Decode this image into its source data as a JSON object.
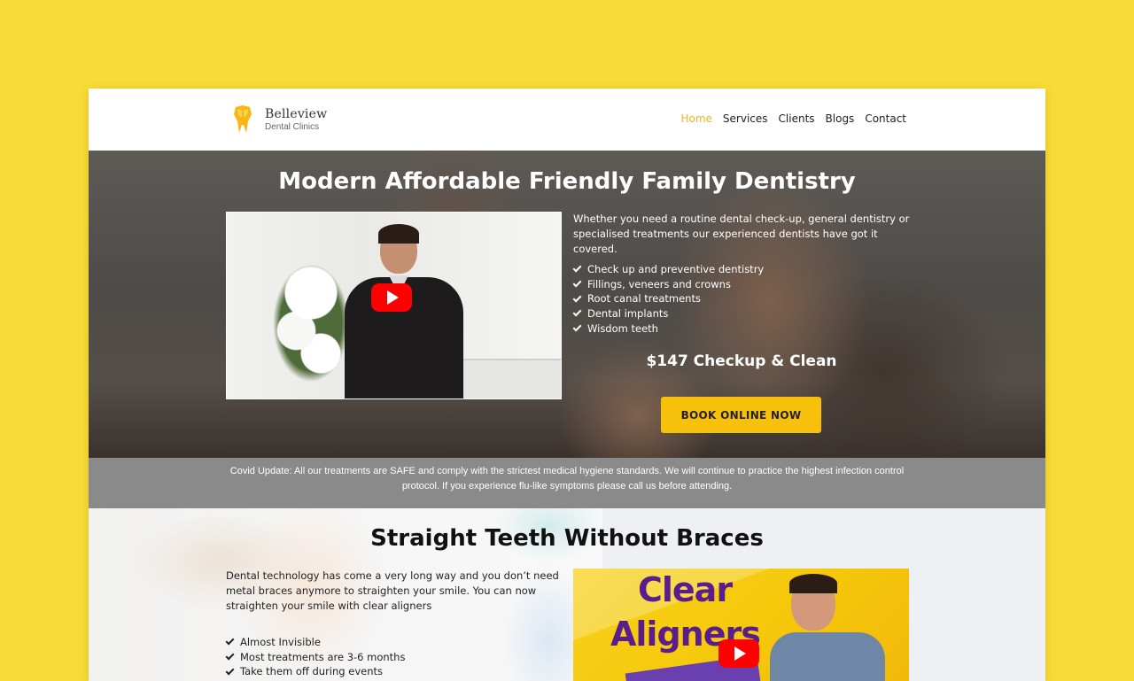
{
  "brand": {
    "name": "Belleview",
    "subtitle": "Dental Clinics",
    "accent": "#f3b21e"
  },
  "nav": {
    "items": [
      {
        "label": "Home",
        "active": true
      },
      {
        "label": "Services",
        "active": false
      },
      {
        "label": "Clients",
        "active": false
      },
      {
        "label": "Blogs",
        "active": false
      },
      {
        "label": "Contact",
        "active": false
      }
    ]
  },
  "hero": {
    "title": "Modern Affordable Friendly Family Dentistry",
    "description": "Whether you need a routine dental check-up, general dentistry or specialised treatments our experienced dentists have got it covered.",
    "features": [
      "Check up and preventive dentistry",
      "Fillings, veneers and crowns",
      "Root canal treatments",
      "Dental implants",
      "Wisdom teeth"
    ],
    "price": "$147 Checkup & Clean",
    "cta": "BOOK ONLINE NOW",
    "video_icon": "youtube-play-icon"
  },
  "covid": {
    "text": "Covid Update: All our treatments are SAFE and comply with the strictest medical hygiene standards. We will continue to practice the highest infection control protocol. If you experience flu-like symptoms please call us before attending."
  },
  "section2": {
    "title": "Straight Teeth Without Braces",
    "description": "Dental technology has come a very long way and you don’t need metal braces anymore to straighten your smile. You can now straighten your smile with clear aligners",
    "features": [
      "Almost Invisible",
      "Most treatments are 3-6 months",
      "Take them off during events"
    ],
    "video_title_line1": "Clear",
    "video_title_line2": "Aligners"
  },
  "colors": {
    "page_bg": "#f9db37",
    "cta_bg": "#f7c00b",
    "covid_bg": "#8a8a8a",
    "video_text": "#5a1e8c"
  }
}
